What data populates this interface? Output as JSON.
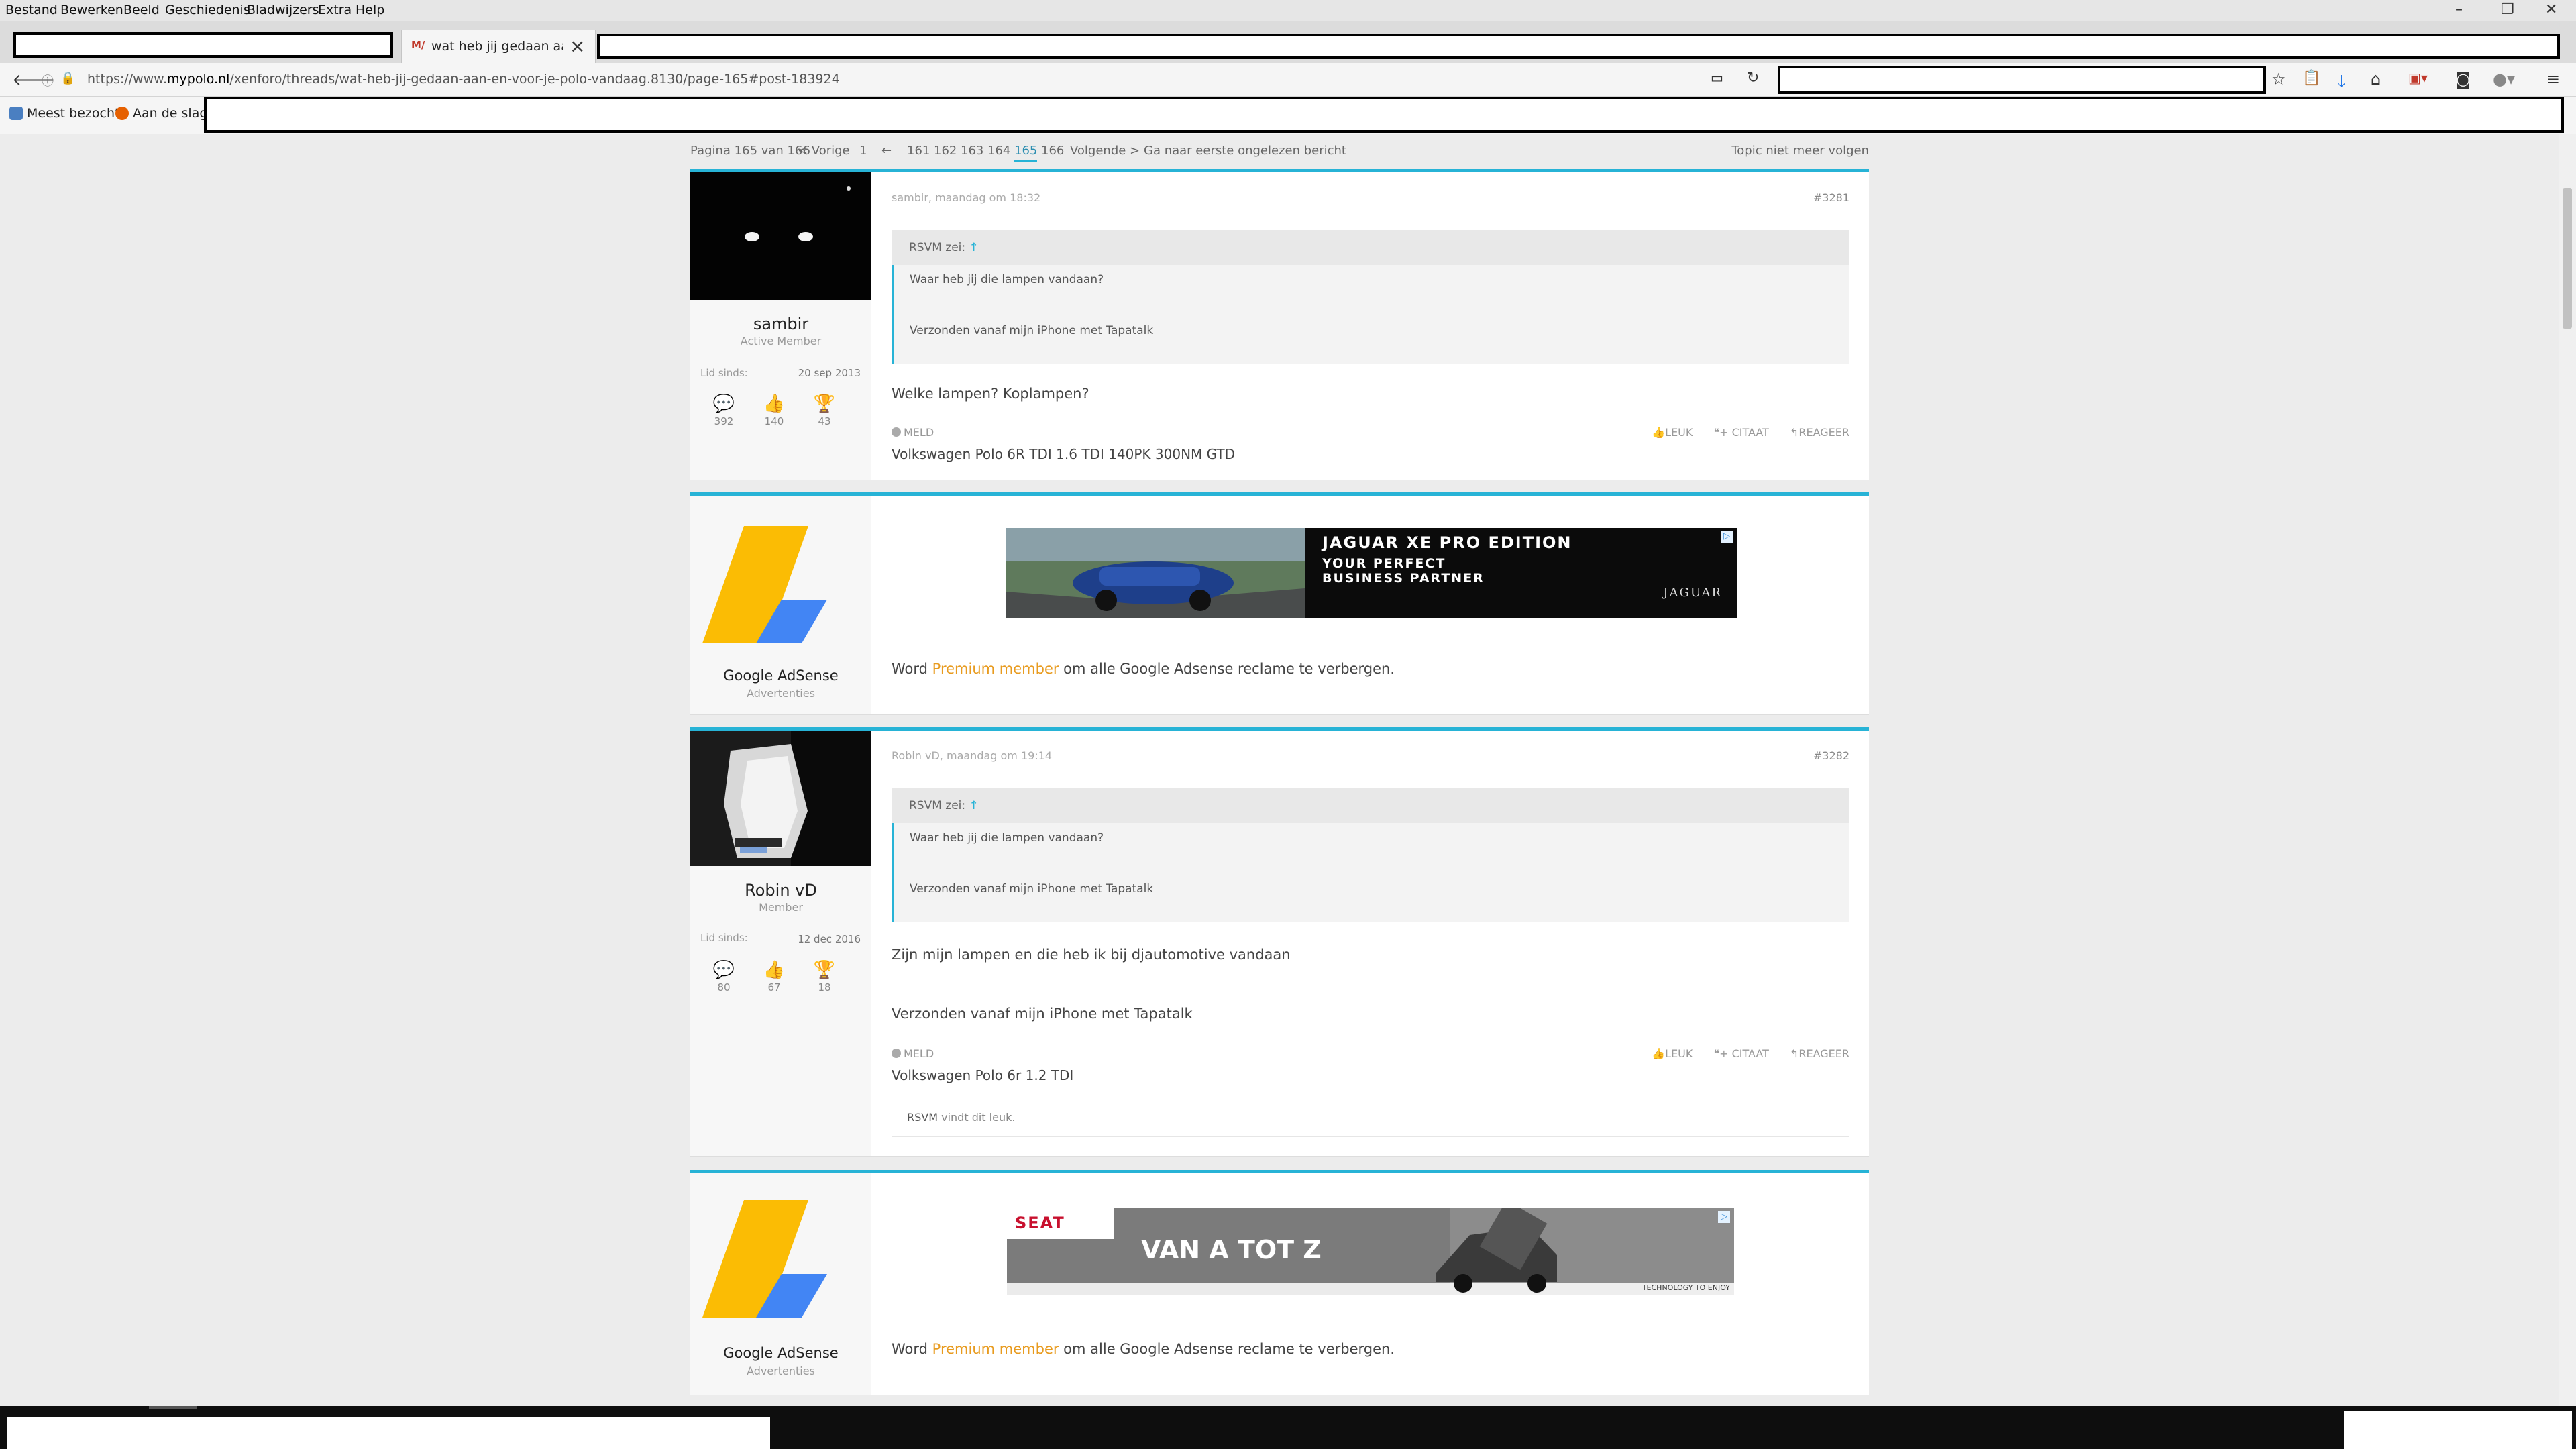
{
  "menubar": {
    "items": [
      "Bestand",
      "Bewerken",
      "Beeld",
      "Geschiedenis",
      "Bladwijzers",
      "Extra",
      "Help"
    ]
  },
  "tab": {
    "title": "wat heb jij gedaan aan e",
    "favicon": "M/"
  },
  "navbar": {
    "url_prefix": "https://www.",
    "url_host": "mypolo.nl",
    "url_path": "/xenforo/threads/wat-heb-jij-gedaan-aan-en-voor-je-polo-vandaag.8130/page-165#post-183924"
  },
  "bookmarks": {
    "items": [
      "Meest bezocht",
      "Aan de slag"
    ]
  },
  "pagination": {
    "label": "Pagina 165 van 166",
    "prev": "< Vorige",
    "first": "1",
    "back_arrow": "←",
    "pages": [
      "161",
      "162",
      "163",
      "164",
      "165",
      "166"
    ],
    "next": "Volgende >",
    "unread": "Ga naar eerste ongelezen bericht",
    "unfollow": "Topic niet meer volgen"
  },
  "posts": [
    {
      "username": "sambir",
      "usertitle": "Active Member",
      "joined_label": "Lid sinds:",
      "joined": "20 sep 2013",
      "messages": "392",
      "likes": "140",
      "points": "43",
      "meta": "sambir, maandag om 18:32",
      "number": "#3281",
      "quote_author": "RSVM zei:",
      "quote_arrow": "↑",
      "quote_line1": "Waar heb jij die lampen vandaan?",
      "quote_line2": "Verzonden vanaf mijn iPhone met Tapatalk",
      "message": "Welke lampen? Koplampen?",
      "report": "MELD",
      "like": "LEUK",
      "quote_btn": "+ CITAAT",
      "reply": "REAGEER",
      "signature": "Volkswagen Polo 6R TDI 1.6 TDI 140PK 300NM GTD"
    },
    {
      "username": "Robin vD",
      "usertitle": "Member",
      "joined_label": "Lid sinds:",
      "joined": "12 dec 2016",
      "messages": "80",
      "likes": "67",
      "points": "18",
      "meta": "Robin vD, maandag om 19:14",
      "number": "#3282",
      "quote_author": "RSVM zei:",
      "quote_arrow": "↑",
      "quote_line1": "Waar heb jij die lampen vandaan?",
      "quote_line2": "Verzonden vanaf mijn iPhone met Tapatalk",
      "message": "Zijn mijn lampen en die heb ik bij djautomotive vandaan",
      "message2": "Verzonden vanaf mijn iPhone met Tapatalk",
      "report": "MELD",
      "like": "LEUK",
      "quote_btn": "+ CITAAT",
      "reply": "REAGEER",
      "signature": "Volkswagen Polo 6r 1.2 TDI",
      "liked_by": "RSVM",
      "liked_text": " vindt dit leuk."
    }
  ],
  "ads": [
    {
      "name": "Google AdSense",
      "subtitle": "Advertenties",
      "banner_line1": "JAGUAR XE PRO EDITION",
      "banner_line2": "YOUR PERFECT",
      "banner_line3": "BUSINESS PARTNER",
      "banner_brand": "JAGUAR",
      "promo_pre": "Word ",
      "promo_link": "Premium member",
      "promo_post": " om alle Google Adsense reclame te verbergen."
    },
    {
      "name": "Google AdSense",
      "subtitle": "Advertenties",
      "banner_brand": "SEAT",
      "banner_slogan": "VAN A TOT Z",
      "banner_tagline": "TECHNOLOGY TO ENJOY",
      "promo_pre": "Word ",
      "promo_link": "Premium member",
      "promo_post": " om alle Google Adsense reclame te verbergen."
    }
  ],
  "colors": {
    "accent": "#27b3d6",
    "premium": "#e89b1f",
    "adsense_yellow": "#fbbc04",
    "adsense_blue": "#4285f4"
  }
}
